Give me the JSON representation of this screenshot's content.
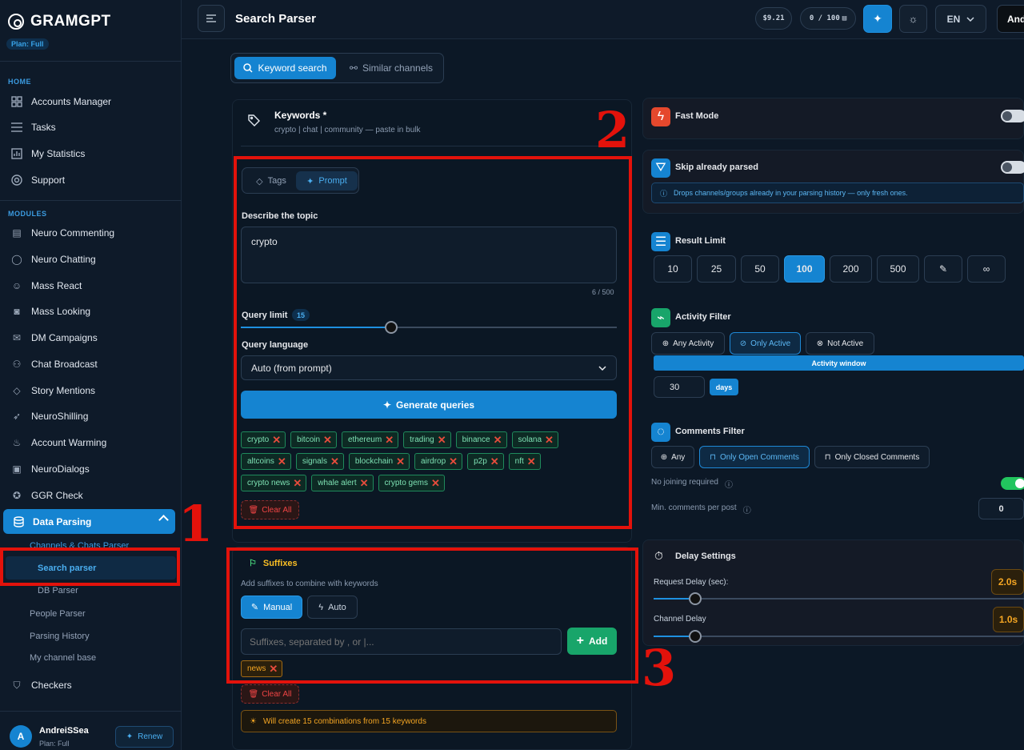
{
  "app": {
    "name": "GRAMGPT",
    "plan_badge": "Plan: Full"
  },
  "sidebar": {
    "home_heading": "HOME",
    "home_items": [
      {
        "label": "Accounts Manager",
        "icon": "grid-icon"
      },
      {
        "label": "Tasks",
        "icon": "list-icon"
      },
      {
        "label": "My Statistics",
        "icon": "stats-icon"
      },
      {
        "label": "Support",
        "icon": "lifebuoy-icon"
      }
    ],
    "modules_heading": "MODULES",
    "module_items": [
      {
        "label": "Neuro Commenting",
        "icon": "comments-icon"
      },
      {
        "label": "Neuro Chatting",
        "icon": "chat-icon"
      },
      {
        "label": "Mass React",
        "icon": "smile-icon"
      },
      {
        "label": "Mass Looking",
        "icon": "eye-monitor-icon"
      },
      {
        "label": "DM Campaigns",
        "icon": "message-plus-icon"
      },
      {
        "label": "Chat Broadcast",
        "icon": "users-icon"
      },
      {
        "label": "Story Mentions",
        "icon": "tag-icon"
      },
      {
        "label": "NeuroShilling",
        "icon": "rocket-icon"
      },
      {
        "label": "Account Warming",
        "icon": "flame-icon"
      },
      {
        "label": "NeuroDialogs",
        "icon": "dialog-icon"
      },
      {
        "label": "GGR Check",
        "icon": "star-icon"
      }
    ],
    "active_item": "Data Parsing",
    "parsing_group": "Channels & Chats Parser",
    "parsing_active": "Search parser",
    "parsing_subs": [
      "DB Parser"
    ],
    "other_subs": [
      "People Parser",
      "Parsing History",
      "My channel base"
    ],
    "checkers": "Checkers",
    "user": {
      "avatar": "A",
      "name": "AndreiSSea",
      "plan": "Plan: Full",
      "renew": "Renew"
    }
  },
  "topbar": {
    "title": "Search Parser",
    "balance": "$9.21",
    "usage": "0 / 100",
    "lang": "EN",
    "user_short": "And"
  },
  "tabs": {
    "keyword": "Keyword search",
    "similar": "Similar channels"
  },
  "keywords": {
    "title": "Keywords *",
    "hint": "crypto | chat | community — paste in bulk",
    "mode_tags": "Tags",
    "mode_prompt": "Prompt",
    "describe_label": "Describe the topic",
    "topic_value": "crypto",
    "char_count": "6 / 500",
    "query_limit_label": "Query limit",
    "query_limit_value": "15",
    "query_limit_fraction": 0.4,
    "query_lang_label": "Query language",
    "query_lang_value": "Auto (from prompt)",
    "generate_label": "Generate queries",
    "tags": [
      [
        "crypto",
        "bitcoin",
        "ethereum",
        "trading",
        "binance",
        "solana"
      ],
      [
        "altcoins",
        "signals",
        "blockchain",
        "airdrop",
        "p2p",
        "nft"
      ],
      [
        "crypto news",
        "whale alert",
        "crypto gems"
      ]
    ],
    "clear_all": "Clear All"
  },
  "suffixes": {
    "title": "Suffixes",
    "desc": "Add suffixes to combine with keywords",
    "manual": "Manual",
    "auto": "Auto",
    "input_placeholder": "Suffixes, separated by , or |...",
    "add": "Add",
    "tags": [
      "news"
    ],
    "clear_all": "Clear All",
    "combos": "Will create 15 combinations from 15 keywords"
  },
  "settings": {
    "fast_mode": "Fast Mode",
    "skip_parsed": "Skip already parsed",
    "skip_info": "Drops channels/groups already in your parsing history — only fresh ones.",
    "result_limit": "Result Limit",
    "limits": [
      "10",
      "25",
      "50",
      "100",
      "200",
      "500",
      "",
      "∞"
    ],
    "selected_limit": "100",
    "activity_filter": "Activity Filter",
    "activity_opts": [
      "Any Activity",
      "Only Active",
      "Not Active"
    ],
    "activity_window": "Activity window",
    "days_value": "30",
    "days_label": "days",
    "comments_filter": "Comments Filter",
    "comments_opts": [
      "Any",
      "Only Open Comments",
      "Only Closed Comments"
    ],
    "no_joining": "No joining required",
    "min_comments": "Min. comments per post",
    "min_comments_value": "0",
    "delay_settings": "Delay Settings",
    "request_delay": "Request Delay (sec):",
    "request_delay_value": "2.0s",
    "channel_delay": "Channel Delay",
    "channel_delay_value": "1.0s"
  },
  "annotations": {
    "n1": "1",
    "n2": "2",
    "n3": "3"
  },
  "colors": {
    "accent": "#1584d1",
    "annotation": "#e3120b",
    "tag_green": "#7ee2b4",
    "suffix_tag": "#f5a623"
  }
}
